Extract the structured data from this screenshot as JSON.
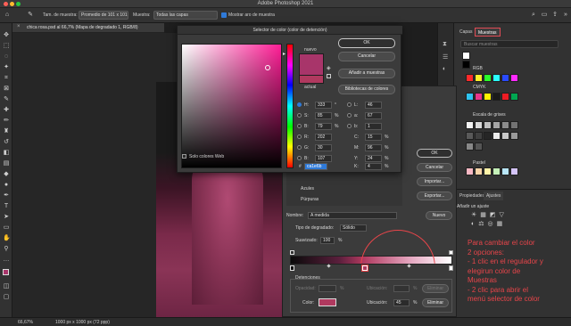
{
  "app": {
    "window_title": "Adobe Photoshop 2021",
    "traffic_colors": [
      "#ff5f57",
      "#febc2e",
      "#28c840"
    ]
  },
  "options_bar": {
    "sample_size_label": "Tam. de muestra:",
    "sample_size_value": "Promedio de 101 x 101",
    "sample_label": "Muestra:",
    "sample_value": "Todas las capas",
    "show_ring_label": "Mostrar aro de muestra"
  },
  "document": {
    "tab_title": "chica rosa.psd al 66,7% (Mapa de degradado 1, RGB/8)",
    "zoom": "66,67%",
    "size_info": "1000 px x 1000 px (72 ppp)"
  },
  "color_picker": {
    "title": "Selector de color (color de detención)",
    "new_label": "nuevo",
    "current_label": "actual",
    "new_color": "#a8356a",
    "current_color": "#b0395f",
    "ok": "OK",
    "cancel": "Cancelar",
    "add_to_swatches": "Añadir a muestras",
    "color_libraries": "Bibliotecas de colores",
    "web_only": "Solo colores Web",
    "fields": {
      "H": {
        "label": "H:",
        "value": "333",
        "unit": "°"
      },
      "S": {
        "label": "S:",
        "value": "85",
        "unit": "%"
      },
      "B": {
        "label": "B:",
        "value": "79",
        "unit": "%"
      },
      "R": {
        "label": "R:",
        "value": "202",
        "unit": ""
      },
      "G": {
        "label": "G:",
        "value": "30",
        "unit": ""
      },
      "Bb": {
        "label": "B:",
        "value": "107",
        "unit": ""
      },
      "L": {
        "label": "L:",
        "value": "46",
        "unit": ""
      },
      "a": {
        "label": "a:",
        "value": "67",
        "unit": ""
      },
      "b": {
        "label": "b:",
        "value": "1",
        "unit": ""
      },
      "C": {
        "label": "C:",
        "value": "15",
        "unit": "%"
      },
      "M": {
        "label": "M:",
        "value": "96",
        "unit": "%"
      },
      "Y": {
        "label": "Y:",
        "value": "24",
        "unit": "%"
      },
      "K": {
        "label": "K:",
        "value": "4",
        "unit": "%"
      }
    },
    "hex_label": "#",
    "hex_value": "ca1e6b"
  },
  "gradient_editor": {
    "ok": "OK",
    "cancel": "Cancelar",
    "import": "Importar...",
    "export": "Exportar...",
    "new": "Nuevo",
    "name_label": "Nombre:",
    "name_value": "A medida",
    "type_label": "Tipo de degradado:",
    "type_value": "Sólido",
    "smooth_label": "Suavizado:",
    "smooth_value": "100",
    "smooth_unit": "%",
    "stops_label": "Detenciones",
    "opacity_label": "Opacidad:",
    "opacity_unit": "%",
    "location_label": "Ubicación:",
    "location_unit": "%",
    "delete": "Eliminar",
    "color_label": "Color:",
    "stop_color": "#b0395f",
    "location2_label": "Ubicación:",
    "location2_value": "45",
    "delete2": "Eliminar",
    "presets": [
      "Azules",
      "Púrpuras"
    ]
  },
  "panels": {
    "tabs": [
      "Capas",
      "Muestras"
    ],
    "search_placeholder": "Buscar muestras",
    "groups": [
      "RGB",
      "CMYK",
      "Escala de grises",
      "Pastel"
    ],
    "adjust_tabs": [
      "Ajustes",
      "Propiedades"
    ],
    "adjust_hint": "Añadir un ajuste"
  },
  "annotation": {
    "lines": [
      "Para cambiar el color",
      "2 opciones:",
      "- 1 clic en el regulador y",
      "elegirun color de",
      "Muestras",
      "- 2 clic para abrir el",
      "menú selector de color"
    ],
    "color": "#e8454a"
  }
}
